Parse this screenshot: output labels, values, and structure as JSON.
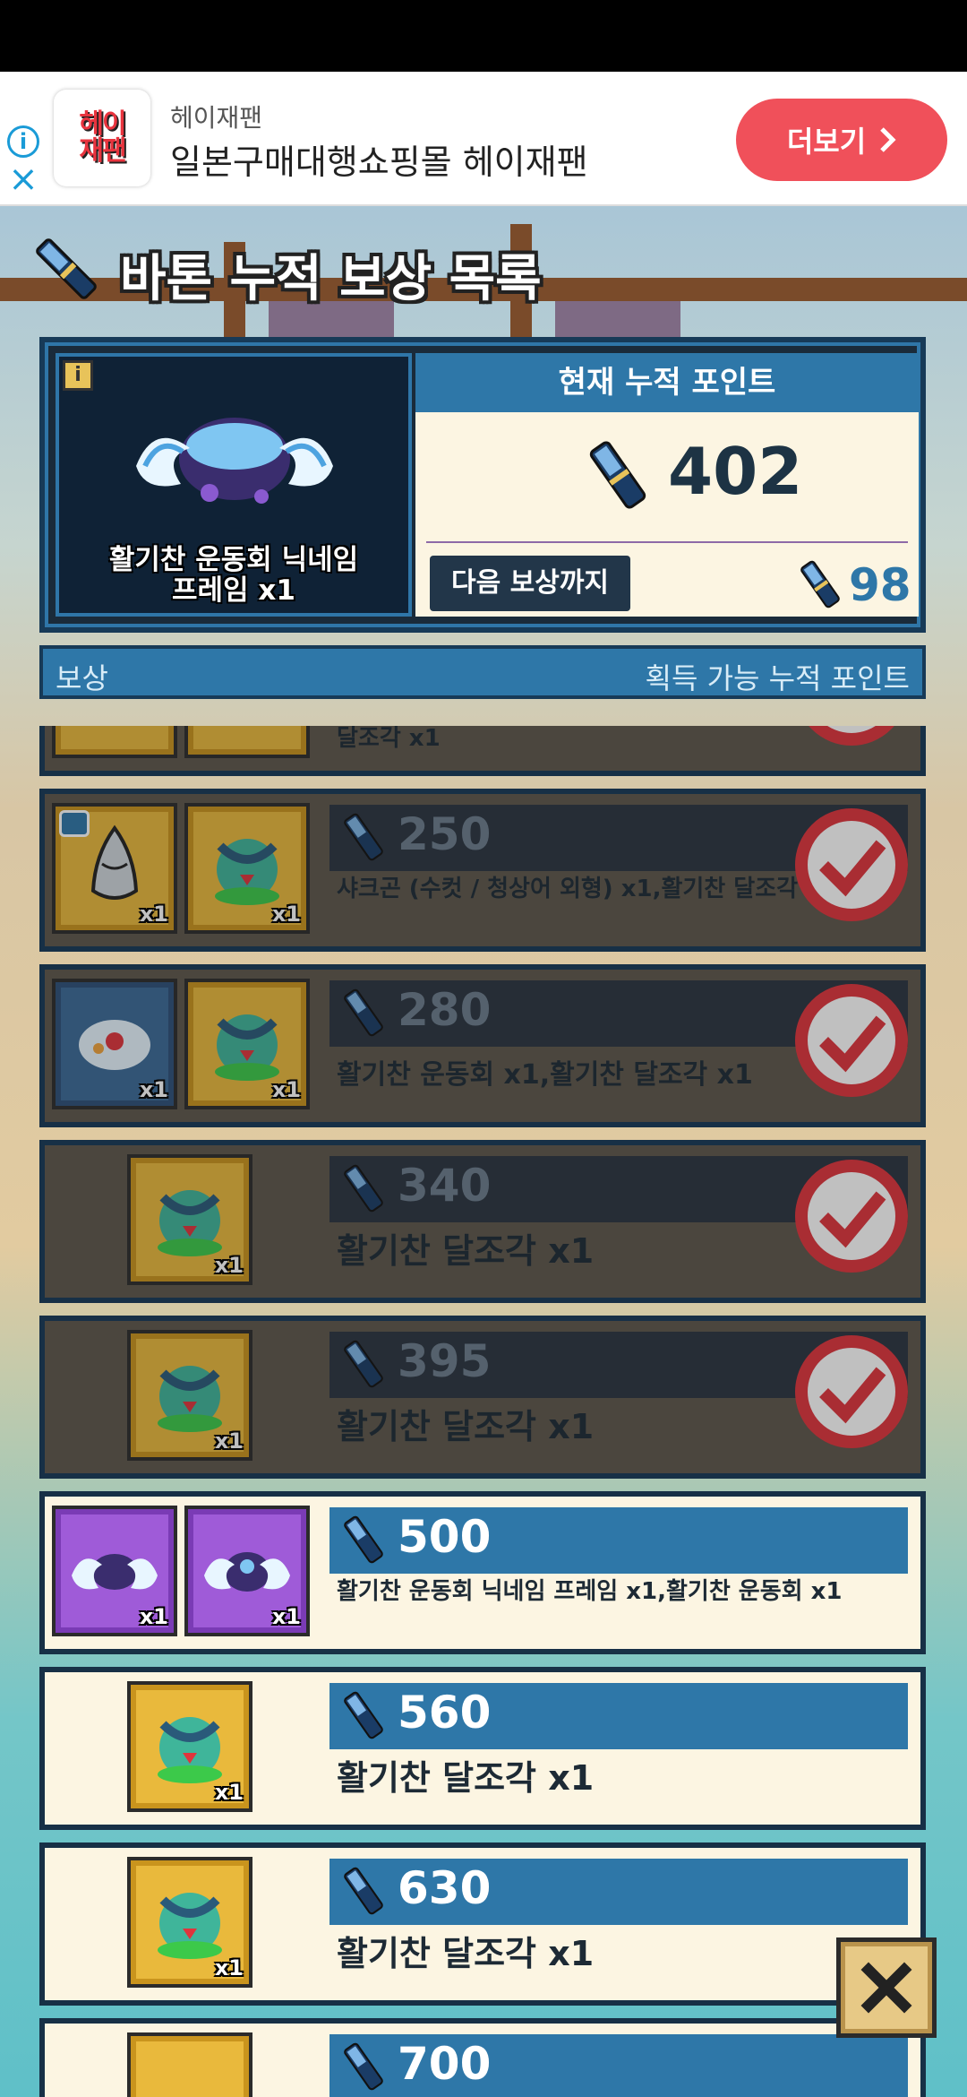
{
  "ad": {
    "brand": "헤이재팬",
    "title": "일본구매대행쇼핑몰 헤이재팬",
    "button_label": "더보기",
    "logo_line1": "헤이",
    "logo_line2": "재팬",
    "info_icon": "info-icon",
    "close_icon": "close-icon"
  },
  "page": {
    "title": "바톤 누적 보상 목록"
  },
  "current": {
    "header": "현재 누적 포인트",
    "points": "402",
    "next_label": "다음 보상까지",
    "next_points": "98",
    "preview_name": "활기찬 운동회 닉네임\n프레임 x1"
  },
  "list_header": {
    "left": "보상",
    "right": "획득 가능 누적 포인트"
  },
  "rewards": [
    {
      "cost": "",
      "desc": "달조각 x1",
      "claimed": true
    },
    {
      "cost": "250",
      "desc": "샤크곤 (수컷 / 청상어 외형) x1,활기찬 달조각 x1",
      "claimed": true,
      "qty1": "x1",
      "qty2": "x1"
    },
    {
      "cost": "280",
      "desc": "활기찬 운동회 x1,활기찬 달조각 x1",
      "claimed": true,
      "qty1": "x1",
      "qty2": "x1"
    },
    {
      "cost": "340",
      "desc": "활기찬 달조각 x1",
      "claimed": true,
      "qty1": "x1"
    },
    {
      "cost": "395",
      "desc": "활기찬 달조각 x1",
      "claimed": true,
      "qty1": "x1"
    },
    {
      "cost": "500",
      "desc": "활기찬 운동회 닉네임 프레임 x1,활기찬 운동회 x1",
      "claimed": false,
      "qty1": "x1",
      "qty2": "x1"
    },
    {
      "cost": "560",
      "desc": "활기찬 달조각 x1",
      "claimed": false,
      "qty1": "x1"
    },
    {
      "cost": "630",
      "desc": "활기찬 달조각 x1",
      "claimed": false,
      "qty1": "x1"
    },
    {
      "cost": "700",
      "desc": "",
      "claimed": false
    }
  ],
  "colors": {
    "accent_blue": "#2e77a8",
    "panel_dark": "#1a2b3a",
    "cream": "#fcf5e2",
    "ad_button": "#f0505a"
  },
  "icons": {
    "baton": "baton-icon",
    "check": "check-stamp-icon",
    "close": "close-x-icon"
  }
}
